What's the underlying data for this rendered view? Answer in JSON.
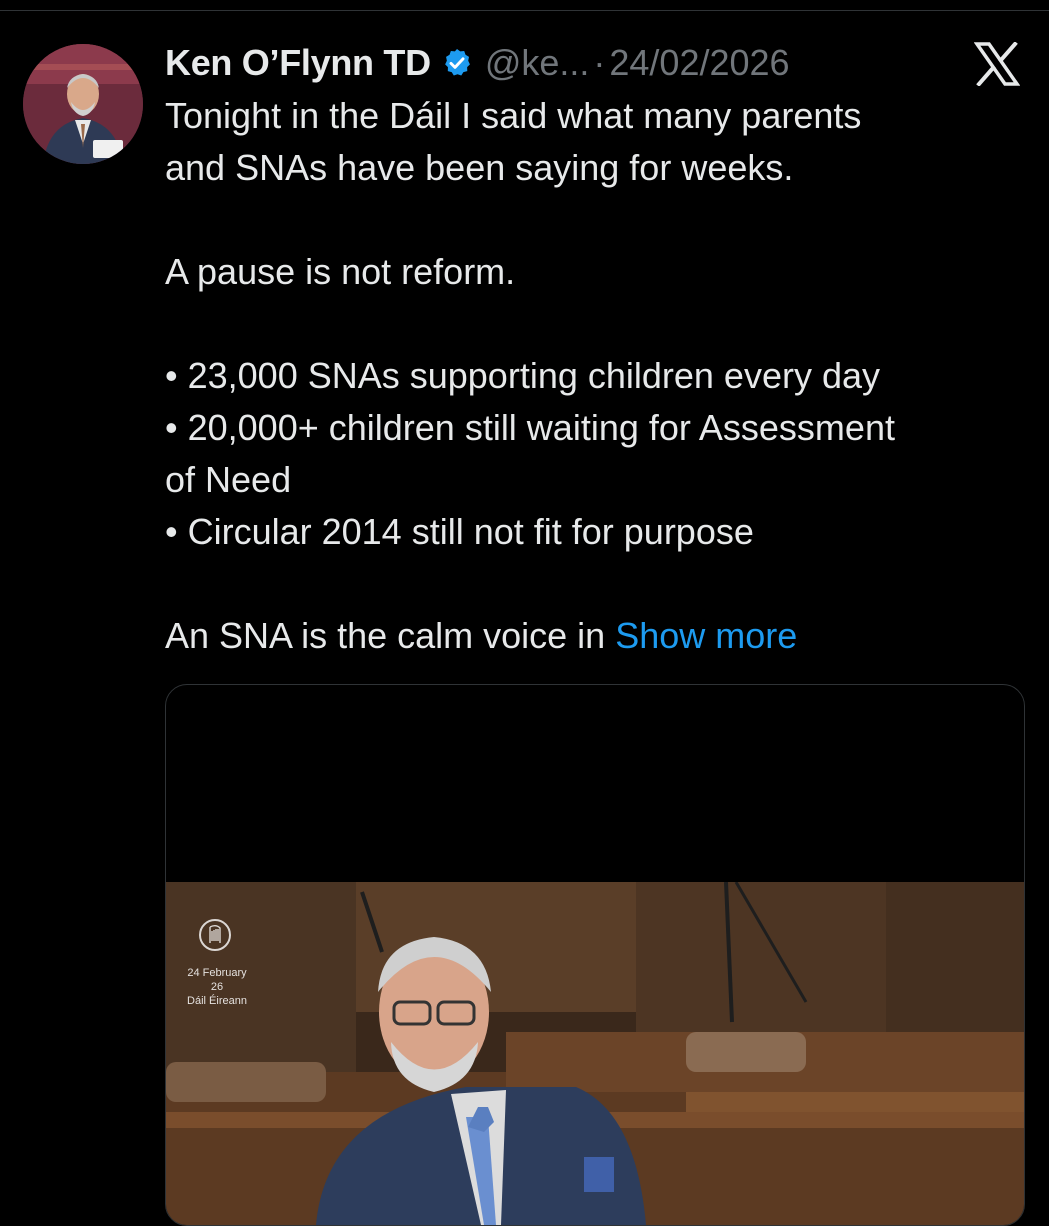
{
  "tweet": {
    "author": {
      "name": "Ken O’Flynn TD",
      "handle": "@ke...",
      "verified": true,
      "avatar_icon": "profile-photo"
    },
    "separator": "·",
    "date": "24/02/2026",
    "platform_icon": "x-logo-icon",
    "text": {
      "line1": "Tonight in the Dáil I said what many parents",
      "line2": "and SNAs have been saying for weeks.",
      "line3": "A pause is not reform.",
      "bullet1": "• 23,000 SNAs supporting children every day",
      "bullet2a": "• 20,000+ children still waiting for Assessment",
      "bullet2b": "of Need",
      "bullet3": "• Circular 2014 still not fit for purpose",
      "last_line": "An SNA is the calm voice in ",
      "show_more": "Show more"
    },
    "media": {
      "type": "video",
      "overlay_date": "24 February 26",
      "overlay_source": "Dáil Éireann"
    }
  },
  "colors": {
    "background": "#000000",
    "text": "#e7e9ea",
    "muted": "#71767b",
    "link": "#1d9bf0",
    "border": "#2f3336"
  }
}
